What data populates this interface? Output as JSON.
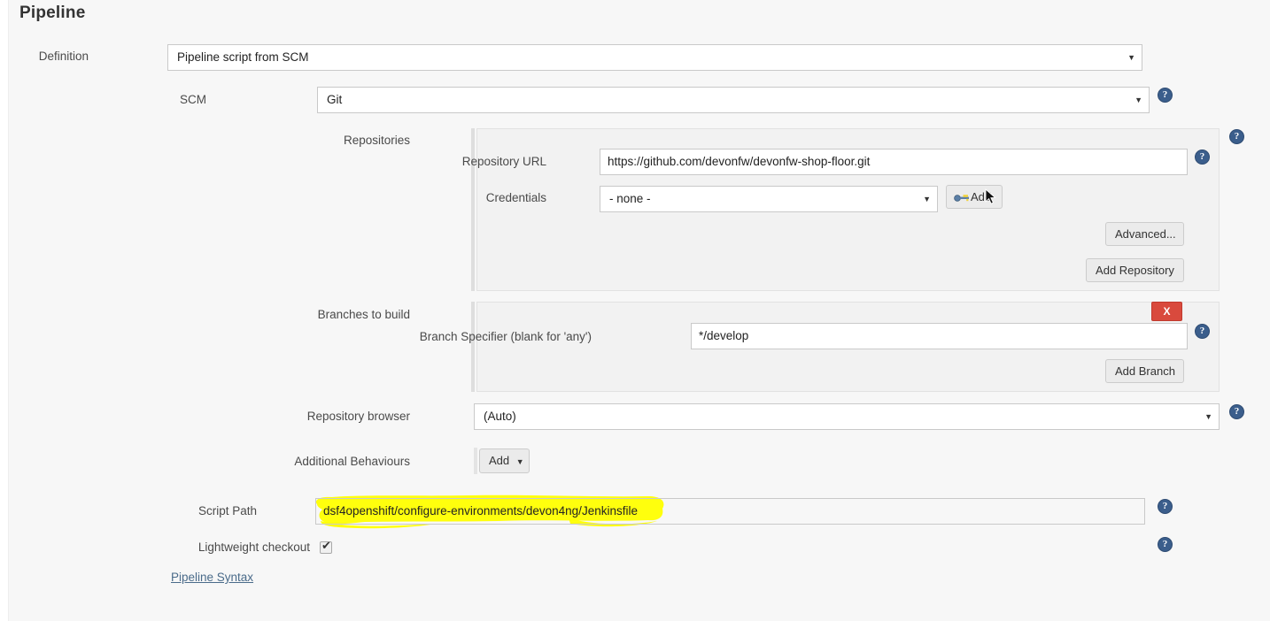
{
  "page": {
    "title": "Pipeline"
  },
  "definition": {
    "label": "Definition",
    "value": "Pipeline script from SCM",
    "caret": "▼"
  },
  "scm": {
    "label": "SCM",
    "value": "Git",
    "caret": "▼",
    "help": "?"
  },
  "repositories": {
    "label": "Repositories",
    "help": "?",
    "repository_url": {
      "label": "Repository URL",
      "value": "https://github.com/devonfw/devonfw-shop-floor.git",
      "help": "?"
    },
    "credentials": {
      "label": "Credentials",
      "value": "- none -",
      "caret": "▼",
      "add_button": "Add"
    },
    "advanced_button": "Advanced...",
    "add_repository_button": "Add Repository"
  },
  "branches": {
    "label": "Branches to build",
    "delete_button": "X",
    "branch_specifier": {
      "label": "Branch Specifier (blank for 'any')",
      "value": "*/develop",
      "help": "?"
    },
    "add_branch_button": "Add Branch"
  },
  "repository_browser": {
    "label": "Repository browser",
    "value": "(Auto)",
    "caret": "▼",
    "help": "?"
  },
  "additional_behaviours": {
    "label": "Additional Behaviours",
    "add_button": "Add",
    "caret": "▼"
  },
  "script_path": {
    "label": "Script Path",
    "value": "dsf4openshift/configure-environments/devon4ng/Jenkinsfile",
    "help": "?"
  },
  "lightweight_checkout": {
    "label": "Lightweight checkout",
    "checked": true,
    "checkmark": "✔",
    "help": "?"
  },
  "pipeline_syntax_link": "Pipeline Syntax",
  "colors": {
    "page_background": "#f7f7f7",
    "panel_background": "#f2f2f2",
    "help_icon": "#3b5e8c",
    "delete_button": "#d94a3d",
    "link": "#4a6b8a",
    "highlight": "#ffff00"
  }
}
